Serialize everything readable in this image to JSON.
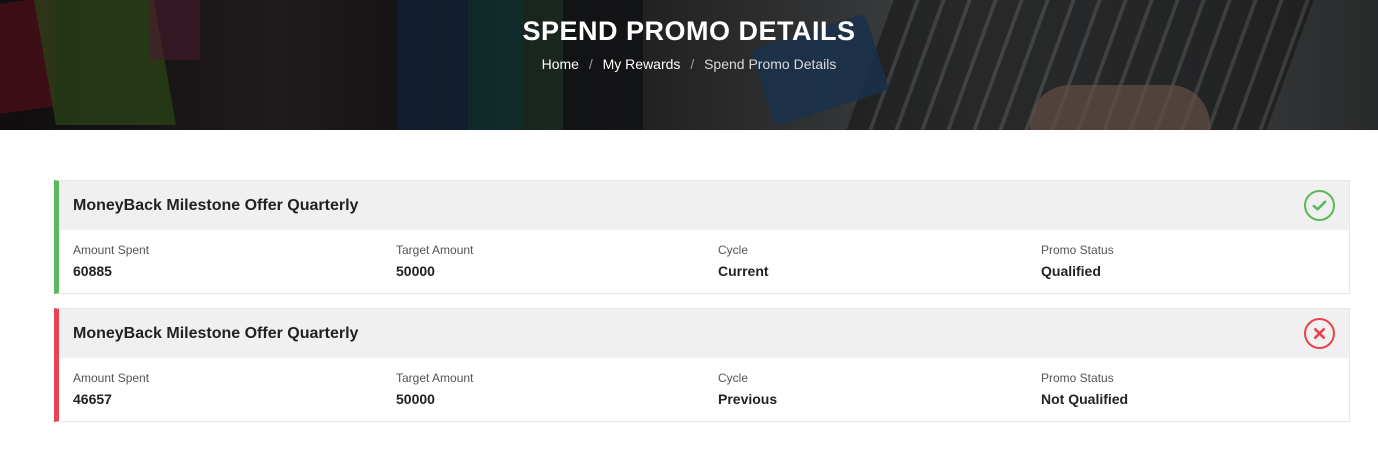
{
  "header": {
    "title": "SPEND PROMO DETAILS",
    "breadcrumb": {
      "home": "Home",
      "separator": "/",
      "rewards": "My Rewards",
      "current": "Spend Promo Details"
    }
  },
  "labels": {
    "amount_spent": "Amount Spent",
    "target_amount": "Target Amount",
    "cycle": "Cycle",
    "promo_status": "Promo Status"
  },
  "promos": [
    {
      "title": "MoneyBack Milestone Offer Quarterly",
      "amount_spent": "60885",
      "target_amount": "50000",
      "cycle": "Current",
      "status": "Qualified",
      "icon": "check-circle-icon",
      "accent": "#5cb85c"
    },
    {
      "title": "MoneyBack Milestone Offer Quarterly",
      "amount_spent": "46657",
      "target_amount": "50000",
      "cycle": "Previous",
      "status": "Not Qualified",
      "icon": "x-circle-icon",
      "accent": "#e8434f"
    }
  ]
}
